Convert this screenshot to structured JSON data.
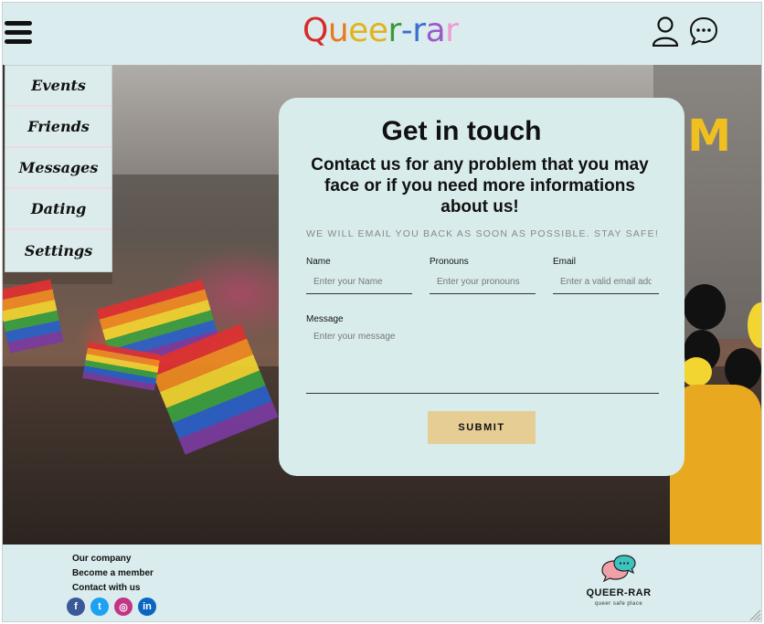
{
  "header": {
    "logo_letters": [
      {
        "ch": "Q",
        "color": "#d72a2a"
      },
      {
        "ch": "u",
        "color": "#e87a1c"
      },
      {
        "ch": "e",
        "color": "#e3b21c"
      },
      {
        "ch": "e",
        "color": "#e3b21c"
      },
      {
        "ch": "r",
        "color": "#3a9a3a"
      },
      {
        "ch": "-",
        "color": "#3a6fd0"
      },
      {
        "ch": "r",
        "color": "#3a6fd0"
      },
      {
        "ch": "a",
        "color": "#9b59c8"
      },
      {
        "ch": "r",
        "color": "#f19ad0"
      }
    ],
    "icons": {
      "menu": "hamburger-menu-icon",
      "user": "user-profile-icon",
      "chat": "chat-bubble-icon"
    }
  },
  "side_menu": {
    "items": [
      "Events",
      "Friends",
      "Messages",
      "Dating",
      "Settings"
    ]
  },
  "contact": {
    "title": "Get in touch",
    "subtitle": "Contact us for any problem that you may face or if you need more informations about us!",
    "note": "WE WILL EMAIL YOU BACK AS SOON AS POSSIBLE. STAY SAFE!",
    "fields": {
      "name_label": "Name",
      "name_placeholder": "Enter your Name",
      "pronouns_label": "Pronouns",
      "pronouns_placeholder": "Enter your pronouns",
      "email_label": "Email",
      "email_placeholder": "Enter a valid email address",
      "message_label": "Message",
      "message_placeholder": "Enter your message"
    },
    "submit_label": "SUBMIT"
  },
  "footer": {
    "links": [
      "Our company",
      "Become a member",
      "Contact with us"
    ],
    "social": [
      {
        "icon": "facebook-icon",
        "glyph": "f",
        "color": "#3b5998"
      },
      {
        "icon": "twitter-icon",
        "glyph": "t",
        "color": "#1da1f2"
      },
      {
        "icon": "instagram-icon",
        "glyph": "◎",
        "color": "#c13584"
      },
      {
        "icon": "linkedin-icon",
        "glyph": "in",
        "color": "#0a66c2"
      }
    ],
    "brand_name": "QUEER-RAR",
    "brand_tagline": "queer safe place"
  },
  "colors": {
    "background": "#d9ecec",
    "menu_divider": "#f0d8e4",
    "submit": "#e6cd94"
  }
}
